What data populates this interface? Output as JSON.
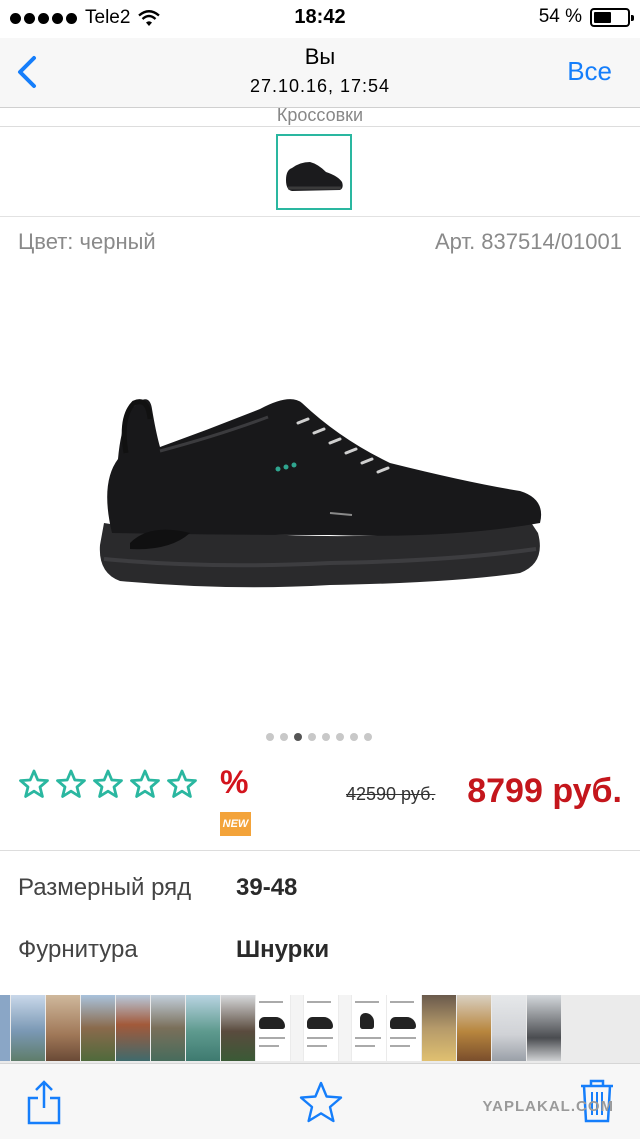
{
  "status_bar": {
    "carrier": "Tele2",
    "time": "18:42",
    "battery_text": "54 %",
    "battery_level": 0.54
  },
  "nav": {
    "title": "Вы",
    "subtitle": "27.10.16, 17:54",
    "all_label": "Все",
    "back_icon": "chevron-left-icon"
  },
  "product": {
    "category": "Кроссовки",
    "color_label": "Цвет: черный",
    "article": "Арт. 837514/01001",
    "gallery_count": 8,
    "gallery_active": 2,
    "rating_stars": 5,
    "discount_symbol": "%",
    "new_badge": "NEW",
    "old_price": "42590 руб.",
    "new_price": "8799 руб.",
    "accent_color": "#2ab7a0",
    "price_color": "#c4161c"
  },
  "specs": [
    {
      "label": "Размерный ряд",
      "value": "39-48"
    },
    {
      "label": "Фурнитура",
      "value": "Шнурки"
    }
  ],
  "toolbar": {
    "share_icon": "share-icon",
    "favorite_icon": "star-outline-icon",
    "delete_icon": "trash-icon"
  },
  "watermark": "YAPLAKAL.COM"
}
